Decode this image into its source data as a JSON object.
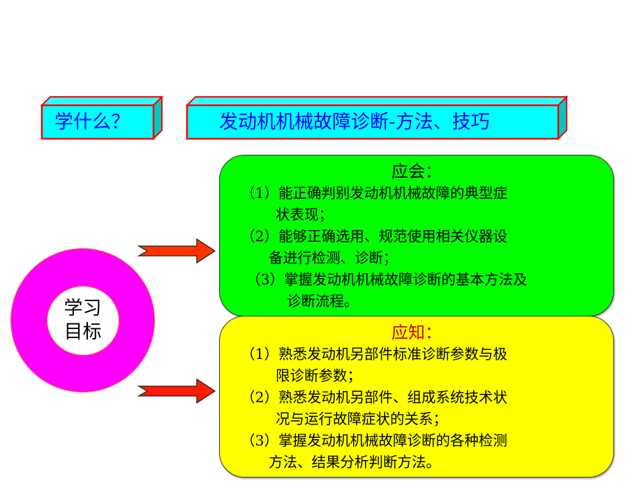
{
  "header": {
    "question_label": "学什么？",
    "topic_title": "发动机机械故障诊断-方法、技巧"
  },
  "goal_circle": {
    "line1": "学习",
    "line2": "目标"
  },
  "colors": {
    "cyan_box": "#33ffff",
    "cyan_side": "#00c8c0",
    "box_border": "#ff0000",
    "title_text": "#0000ff",
    "green_panel": "#00ff00",
    "yellow_panel": "#ffff00",
    "ring": "#ff00ff",
    "arrow": "#ff3300",
    "know_heading": "#cc0000"
  },
  "should_be_able": {
    "heading": "应会：",
    "lines": [
      "（1）能正确判别发动机机械故障的典型症",
      "状表现；",
      "（2）能够正确选用、规范使用相关仪器设",
      "备进行检测、诊断；",
      "（3）掌握发动机机械故障诊断的基本方法及",
      "诊断流程。"
    ]
  },
  "should_know": {
    "heading": "应知：",
    "lines": [
      "（1）熟悉发动机另部件标准诊断参数与极",
      "限诊断参数；",
      "（2）熟悉发动机另部件、组成系统技术状",
      "况与运行故障症状的关系；",
      "（3）掌握发动机机械故障诊断的各种检测",
      "方法、结果分析判断方法。"
    ]
  }
}
